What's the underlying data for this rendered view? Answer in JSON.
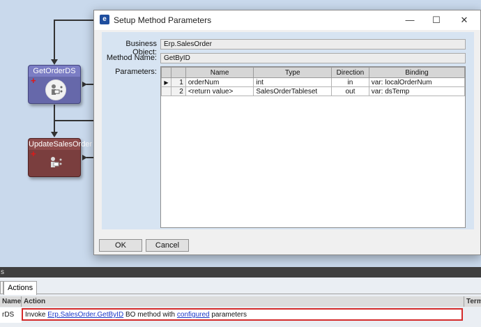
{
  "canvas": {
    "nodes": [
      {
        "title": "GetOrderDS"
      },
      {
        "title": "UpdateSalesOrder"
      }
    ]
  },
  "dialog": {
    "title": "Setup Method Parameters",
    "business_object_label": "Business Object:",
    "business_object_value": "Erp.SalesOrder",
    "method_name_label": "Method Name:",
    "method_name_value": "GetByID",
    "parameters_label": "Parameters:",
    "grid": {
      "columns": [
        "Name",
        "Type",
        "Direction",
        "Binding"
      ],
      "rows": [
        {
          "num": "1",
          "name": "orderNum",
          "type": "int",
          "direction": "in",
          "binding": "var: localOrderNum"
        },
        {
          "num": "2",
          "name": "<return value>",
          "type": "SalesOrderTableset",
          "direction": "out",
          "binding": "var: dsTemp"
        }
      ]
    },
    "ok_label": "OK",
    "cancel_label": "Cancel"
  },
  "bottom": {
    "bar_text": "s",
    "tab_label": "Actions",
    "columns": {
      "name": "Name",
      "action": "Action",
      "extra": "Term"
    },
    "row": {
      "name": "rDS",
      "action_prefix": "Invoke ",
      "action_link": "Erp.SalesOrder.GetByID",
      "action_middle": " BO method with ",
      "action_link2": "configured",
      "action_suffix": " parameters"
    }
  }
}
